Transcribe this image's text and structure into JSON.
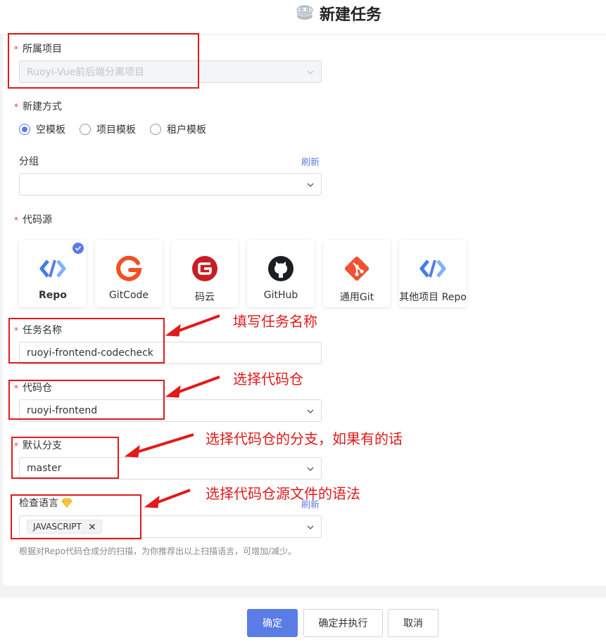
{
  "header": {
    "title": "新建任务",
    "icon": "repo-stack-icon"
  },
  "form": {
    "project": {
      "label": "所属项目",
      "value": "Ruoyi-Vue前后端分离项目"
    },
    "method": {
      "label": "新建方式",
      "options": [
        {
          "label": "空模板",
          "selected": true
        },
        {
          "label": "项目模板",
          "selected": false
        },
        {
          "label": "租户模板",
          "selected": false
        }
      ]
    },
    "group": {
      "label": "分组",
      "refresh": "刷新",
      "value": ""
    },
    "code_source": {
      "label": "代码源",
      "sources": [
        {
          "name": "Repo",
          "icon": "repo-icon",
          "selected": true
        },
        {
          "name": "GitCode",
          "icon": "gitcode-icon",
          "selected": false
        },
        {
          "name": "码云",
          "icon": "gitee-icon",
          "selected": false
        },
        {
          "name": "GitHub",
          "icon": "github-icon",
          "selected": false
        },
        {
          "name": "通用Git",
          "icon": "git-icon",
          "selected": false
        },
        {
          "name": "其他项目 Repo",
          "icon": "repo-icon",
          "selected": false
        }
      ]
    },
    "task_name": {
      "label": "任务名称",
      "value": "ruoyi-frontend-codecheck"
    },
    "repo": {
      "label": "代码仓",
      "value": "ruoyi-frontend"
    },
    "branch": {
      "label": "默认分支",
      "value": "master"
    },
    "language": {
      "label": "检查语言",
      "refresh": "刷新",
      "tags": [
        "JAVASCRIPT"
      ],
      "hint": "根据对Repo代码仓成分的扫描，为你推荐出以上扫描语言，可增加/减少。"
    }
  },
  "annotations": {
    "task_name": "填写任务名称",
    "repo": "选择代码仓",
    "branch": "选择代码仓的分支，如果有的话",
    "language": "选择代码仓源文件的语法"
  },
  "footer": {
    "confirm": "确定",
    "confirm_run": "确定并执行",
    "cancel": "取消"
  },
  "colors": {
    "primary": "#5b7ce6",
    "required": "#e5403a",
    "annotation": "#e11a1a"
  }
}
